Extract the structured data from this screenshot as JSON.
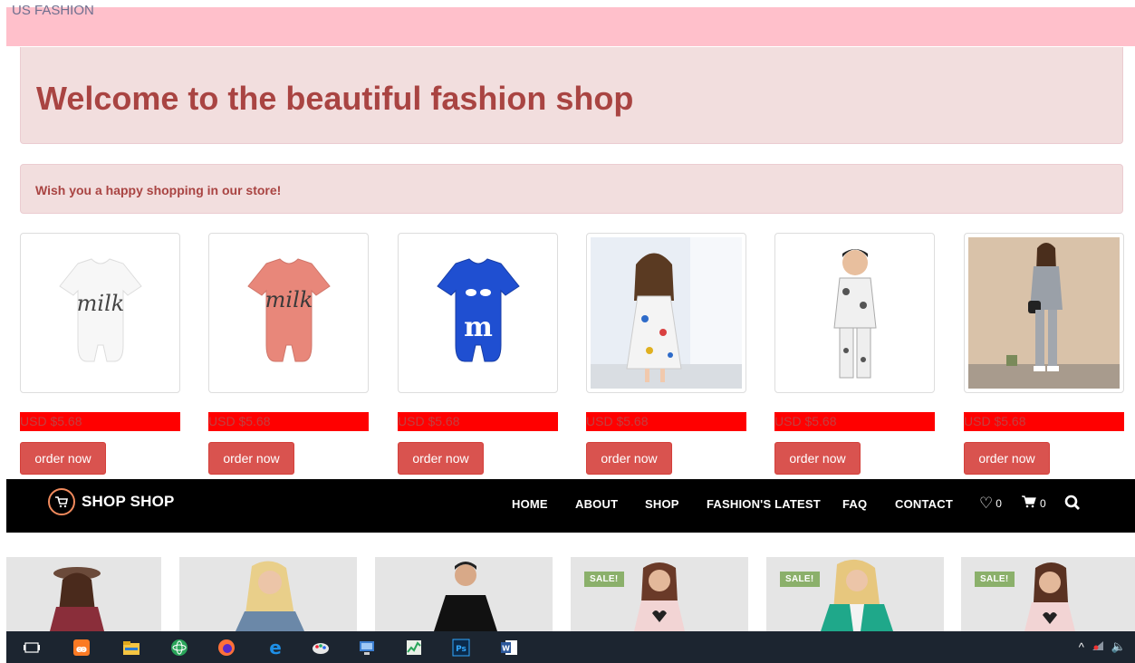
{
  "header": {
    "site_title": "US FASHION"
  },
  "jumbotron": {
    "heading": "Welcome to the beautiful fashion shop"
  },
  "alert": {
    "message": "Wish you a happy shopping in our store!"
  },
  "products": [
    {
      "price": "USD $5.68",
      "button": "order now",
      "image": "white-milk-romper"
    },
    {
      "price": "USD $5.68",
      "button": "order now",
      "image": "pink-milk-romper"
    },
    {
      "price": "USD $5.68",
      "button": "order now",
      "image": "blue-m-romper"
    },
    {
      "price": "USD $5.68",
      "button": "order now",
      "image": "girl-printed-dress"
    },
    {
      "price": "USD $5.68",
      "button": "order now",
      "image": "boy-printed-suit"
    },
    {
      "price": "USD $5.68",
      "button": "order now",
      "image": "girl-grey-outfit"
    }
  ],
  "navbar": {
    "brand": "SHOP SHOP",
    "links": [
      "HOME",
      "ABOUT",
      "SHOP",
      "FASHION'S LATEST",
      "FAQ",
      "CONTACT"
    ],
    "wishlist_count": "0",
    "cart_count": "0"
  },
  "gallery": {
    "sale_label": "SALE!"
  },
  "colors": {
    "header_pink": "#ffc0cb",
    "alert_bg": "#f2dede",
    "alert_text": "#a94442",
    "price_bar": "#ff0000",
    "button_red": "#d9534f",
    "navbar": "#000000",
    "taskbar": "#1c2530"
  }
}
